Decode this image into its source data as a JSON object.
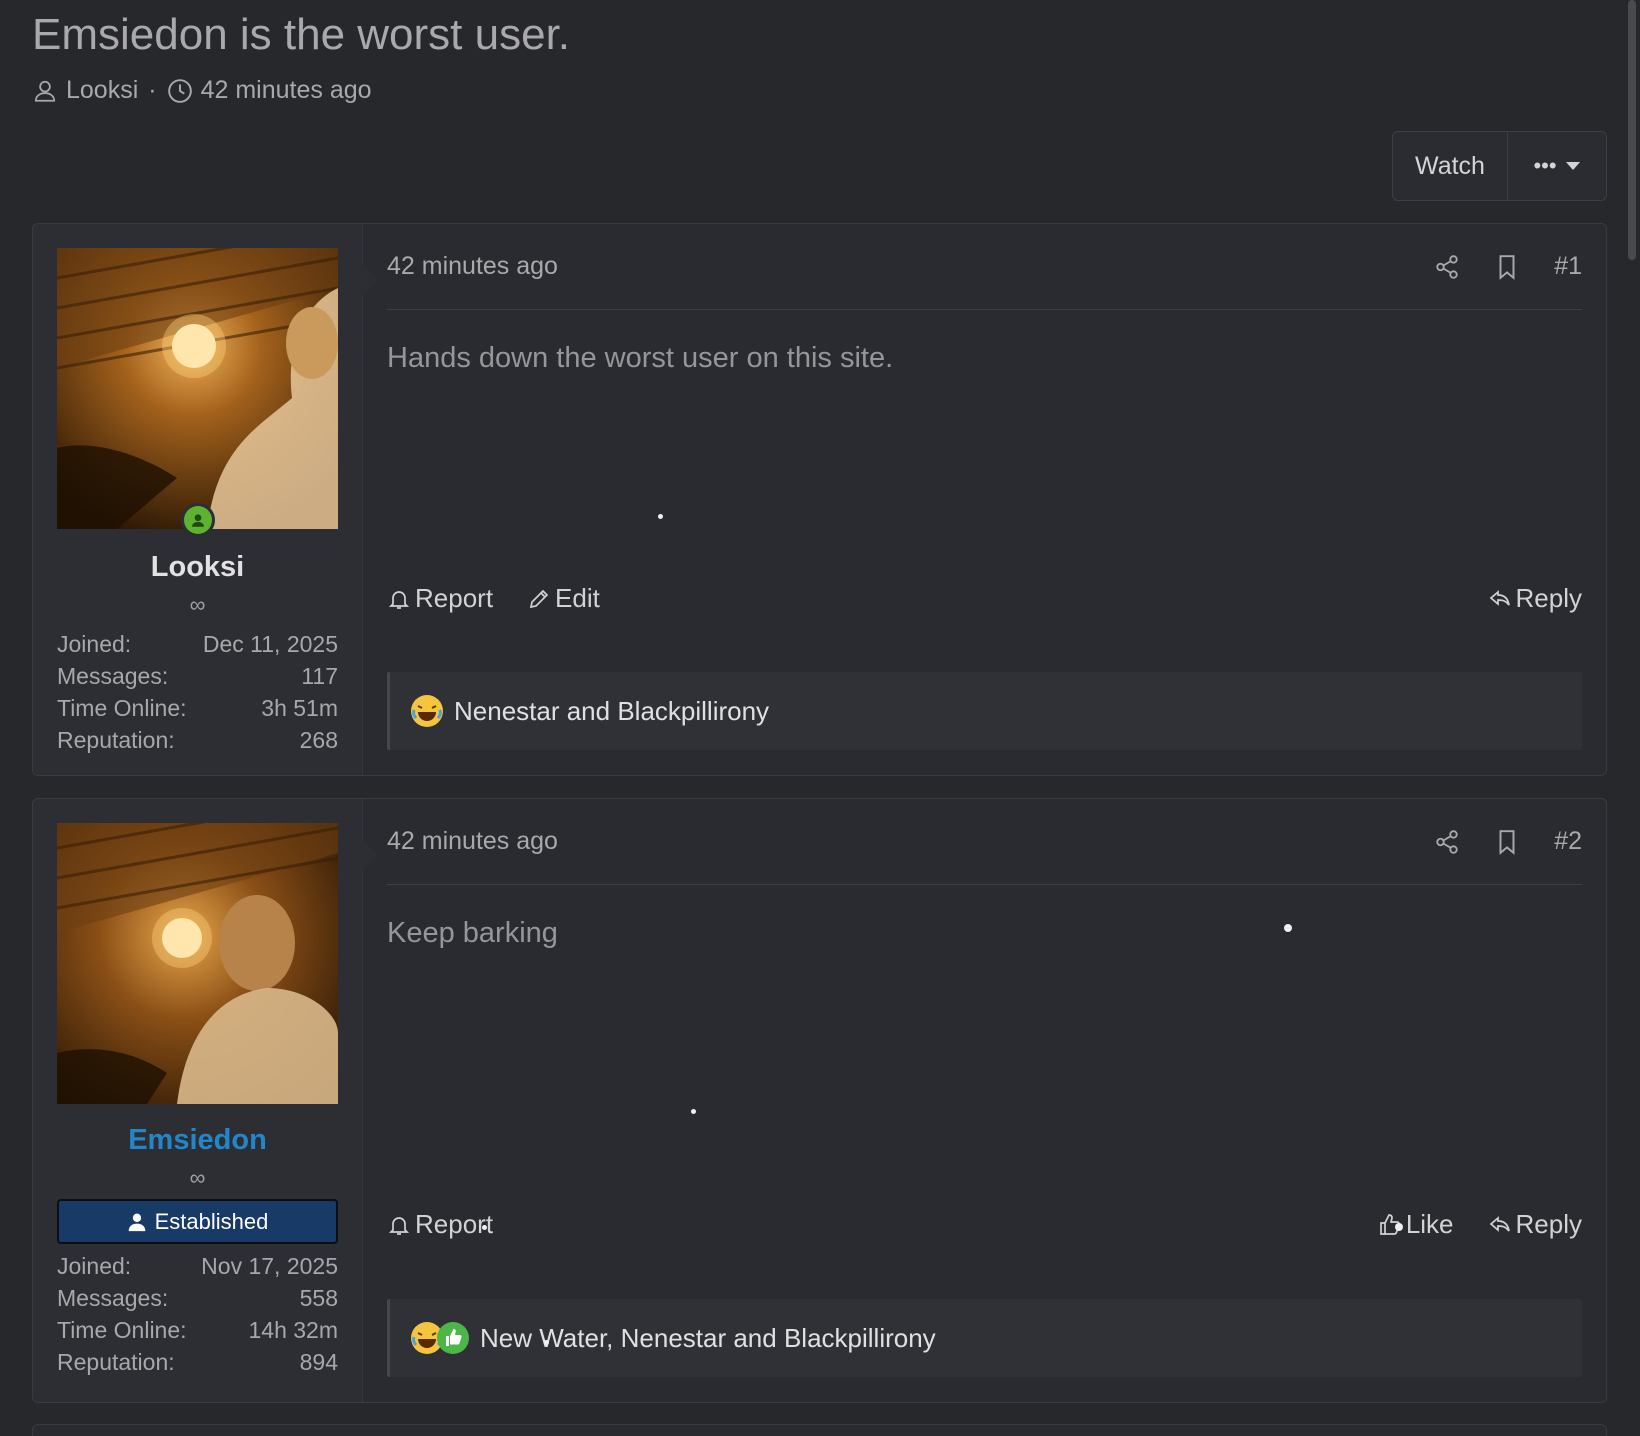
{
  "thread": {
    "title": "Emsiedon is the worst user.",
    "author": "Looksi",
    "separator": "·",
    "time": "42 minutes ago"
  },
  "toolbar": {
    "watch_label": "Watch",
    "more_label": "•••"
  },
  "posts": [
    {
      "username": "Looksi",
      "username_color": "#e2e2e4",
      "infinity": "∞",
      "banner": null,
      "stats": [
        {
          "label": "Joined:",
          "value": "Dec 11, 2025"
        },
        {
          "label": "Messages:",
          "value": "117"
        },
        {
          "label": "Time Online:",
          "value": "3h 51m"
        },
        {
          "label": "Reputation:",
          "value": "268"
        }
      ],
      "time": "42 minutes ago",
      "number": "#1",
      "body": "Hands down the worst user on this site.",
      "actions_left": [
        "Report",
        "Edit"
      ],
      "actions_right": [
        "Reply"
      ],
      "reactions_text": "Nenestar and Blackpillirony"
    },
    {
      "username": "Emsiedon",
      "username_color": "#2287c9",
      "infinity": "∞",
      "banner": "Established",
      "stats": [
        {
          "label": "Joined:",
          "value": "Nov 17, 2025"
        },
        {
          "label": "Messages:",
          "value": "558"
        },
        {
          "label": "Time Online:",
          "value": "14h 32m"
        },
        {
          "label": "Reputation:",
          "value": "894"
        }
      ],
      "time": "42 minutes ago",
      "number": "#2",
      "body": "Keep barking",
      "actions_left": [
        "Report"
      ],
      "actions_right": [
        "Like",
        "Reply"
      ],
      "reactions_text": "New Water, Nenestar and Blackpillirony"
    }
  ]
}
